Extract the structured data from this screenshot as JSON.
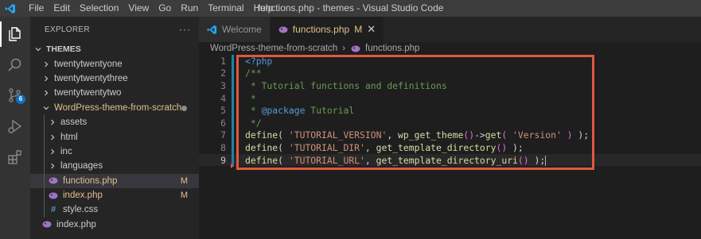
{
  "window": {
    "title": "functions.php - themes - Visual Studio Code",
    "menu": [
      "File",
      "Edit",
      "Selection",
      "View",
      "Go",
      "Run",
      "Terminal",
      "Help"
    ]
  },
  "activity_bar": {
    "items": [
      "explorer",
      "search",
      "source-control",
      "run-debug",
      "extensions"
    ],
    "source_control_badge": "6"
  },
  "sidebar": {
    "title": "EXPLORER",
    "more": "···",
    "root": "THEMES",
    "folders": [
      "twentytwentyone",
      "twentytwentythree",
      "twentytwentytwo"
    ],
    "project": {
      "name": "WordPress-theme-from-scratch",
      "subfolders": [
        "assets",
        "html",
        "inc",
        "languages"
      ],
      "files": [
        {
          "name": "functions.php",
          "status": "M"
        },
        {
          "name": "index.php",
          "status": "M"
        },
        {
          "name": "style.css",
          "status": ""
        }
      ]
    },
    "root_files": [
      "index.php"
    ]
  },
  "tabs": [
    {
      "label": "Welcome",
      "active": false
    },
    {
      "label": "functions.php",
      "status": "M",
      "active": true,
      "close": "✕"
    }
  ],
  "breadcrumb": {
    "folder": "WordPress-theme-from-scratch",
    "separator": "›",
    "file": "functions.php"
  },
  "editor": {
    "line_numbers": [
      "1",
      "2",
      "3",
      "4",
      "5",
      "6",
      "7",
      "8",
      "9"
    ],
    "current_line": 9,
    "code": {
      "l1": "<?php",
      "l2": "/**",
      "l3": " * Tutorial functions and definitions",
      "l4": " *",
      "l5_a": " * ",
      "l5_b": "@package",
      "l5_c": " Tutorial",
      "l6": " */",
      "l7": {
        "fn": "define",
        "s1": "'TUTORIAL_VERSION'",
        "fn2": "wp_get_theme",
        "fn3": "get",
        "s2": "'Version'"
      },
      "l8": {
        "fn": "define",
        "s1": "'TUTORIAL_DIR'",
        "fn2": "get_template_directory"
      },
      "l9": {
        "fn": "define",
        "s1": "'TUTORIAL_URL'",
        "fn2": "get_template_directory_uri"
      }
    }
  },
  "colors": {
    "accent_highlight": "#e0583f",
    "modified": "#e2c08d",
    "badge": "#0e70c0"
  }
}
